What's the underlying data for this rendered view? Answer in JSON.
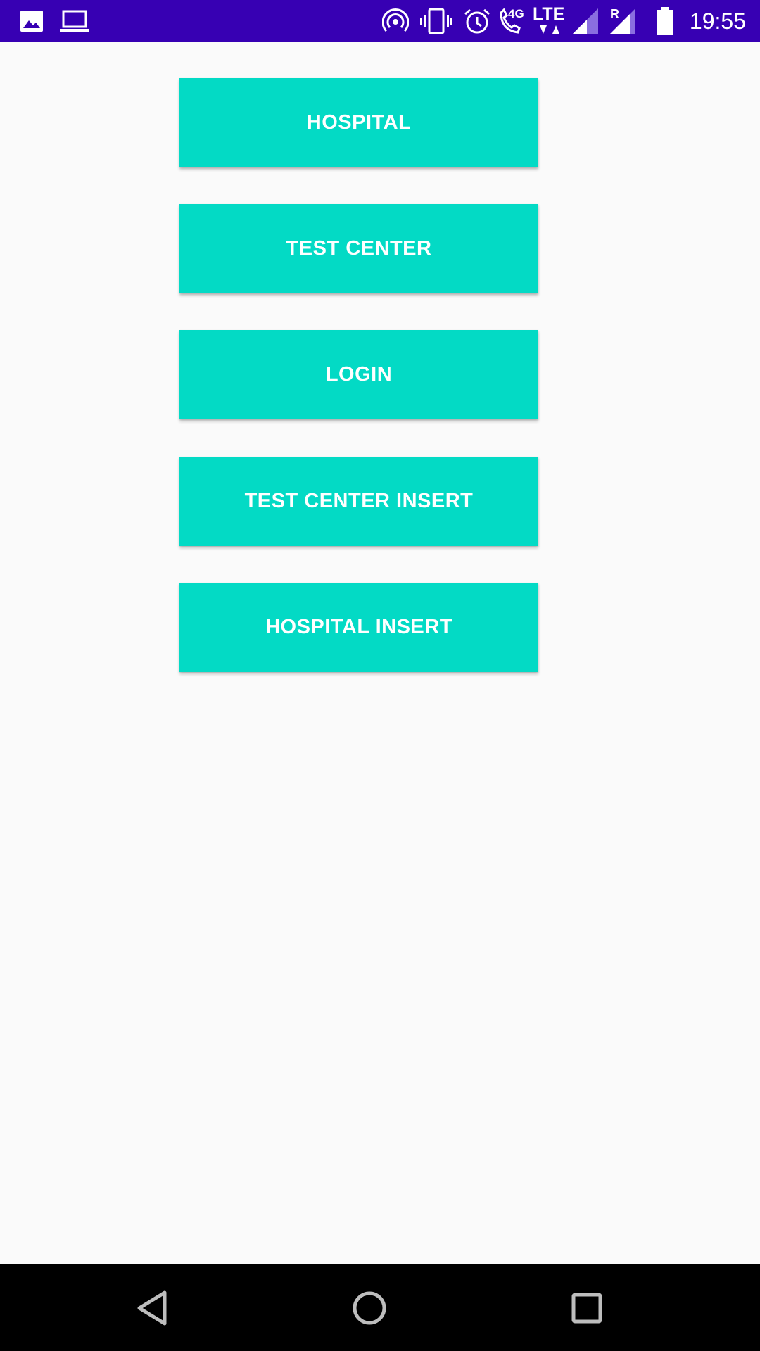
{
  "status_bar": {
    "time": "19:55",
    "background": "#3700b3",
    "notification_icons": [
      "image-icon",
      "laptop-icon"
    ],
    "system_icons": [
      "hotspot-icon",
      "vibrate-icon",
      "alarm-icon",
      "volte-call-icon",
      "lte-data-icon",
      "signal-icon",
      "roaming-signal-icon",
      "battery-icon"
    ],
    "network_label": "LTE",
    "call_label": "4G",
    "roaming_label": "R"
  },
  "theme": {
    "accent": "#03dac5",
    "button_text": "#ffffff",
    "background": "#fafafa"
  },
  "buttons": [
    {
      "label": "HOSPITAL"
    },
    {
      "label": "TEST CENTER"
    },
    {
      "label": "LOGIN"
    },
    {
      "label": "TEST CENTER INSERT"
    },
    {
      "label": "HOSPITAL INSERT"
    }
  ],
  "nav_bar": {
    "items": [
      "back-icon",
      "home-icon",
      "recents-icon"
    ]
  }
}
